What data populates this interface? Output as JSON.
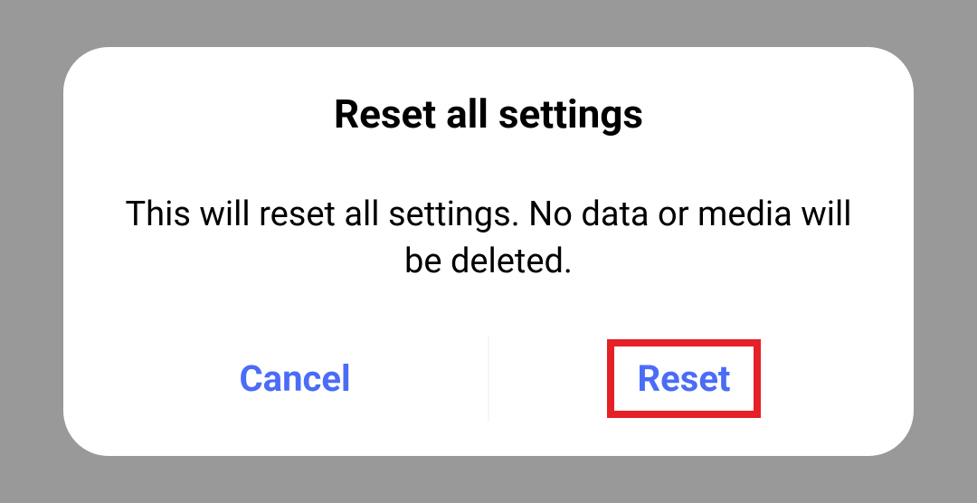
{
  "dialog": {
    "title": "Reset all settings",
    "message": "This will reset all settings. No data or media will be deleted.",
    "cancel_label": "Cancel",
    "confirm_label": "Reset"
  }
}
